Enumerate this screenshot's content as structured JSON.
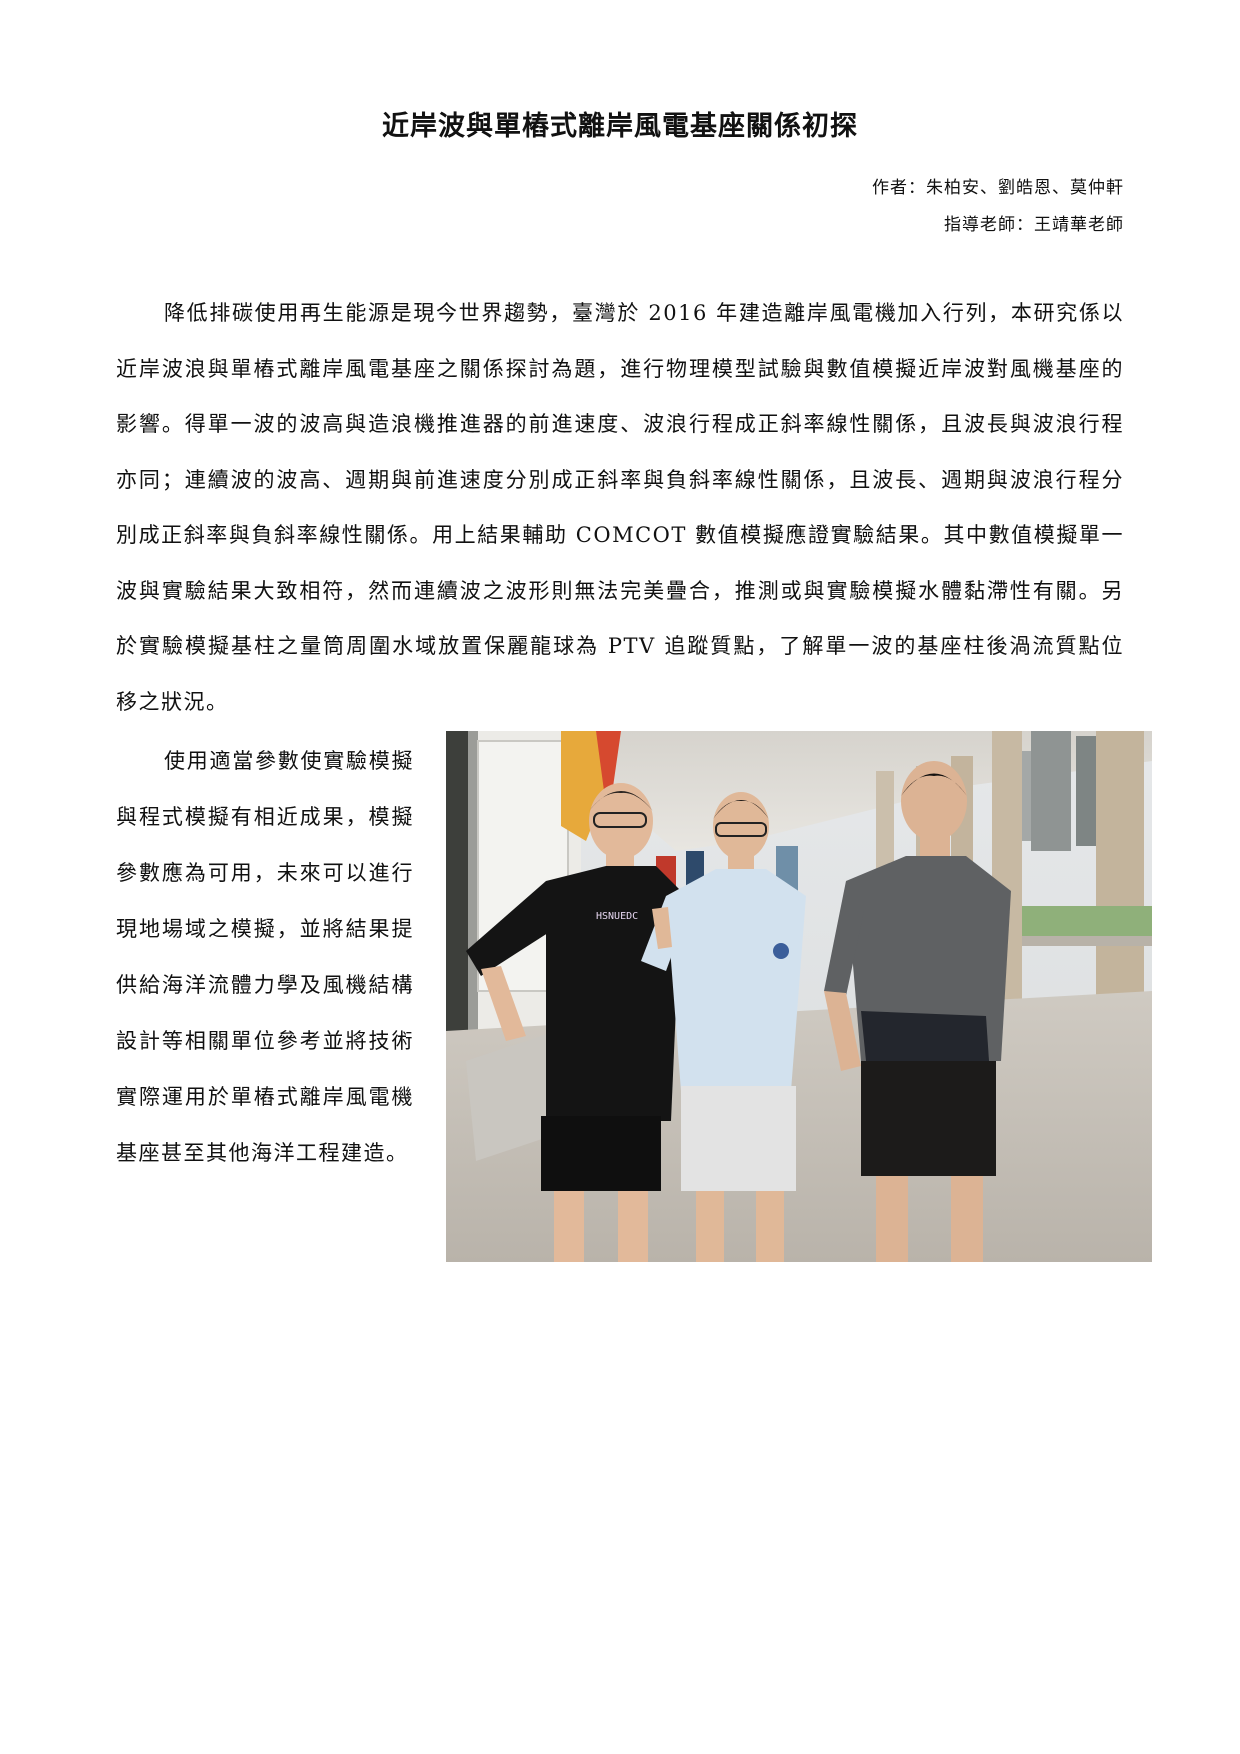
{
  "document": {
    "title": "近岸波與單樁式離岸風電基座關係初探",
    "authors_line": "作者：朱柏安、劉皓恩、莫仲軒",
    "advisor_line": "指導老師：王靖華老師",
    "abstract": "降低排碳使用再生能源是現今世界趨勢，臺灣於 2016 年建造離岸風電機加入行列，本研究係以近岸波浪與單樁式離岸風電基座之關係探討為題，進行物理模型試驗與數值模擬近岸波對風機基座的影響。得單一波的波高與造浪機推進器的前進速度、波浪行程成正斜率線性關係，且波長與波浪行程亦同；連續波的波高、週期與前進速度分別成正斜率與負斜率線性關係，且波長、週期與波浪行程分別成正斜率與負斜率線性關係。用上結果輔助 COMCOT 數值模擬應證實驗結果。其中數值模擬單一波與實驗結果大致相符，然而連續波之波形則無法完美疊合，推測或與實驗模擬水體黏滯性有關。另於實驗模擬基柱之量筒周圍水域放置保麗龍球為 PTV 追蹤質點，了解單一波的基座柱後渦流質點位移之狀況。",
    "closing": "使用適當參數使實驗模擬與程式模擬有相近成果，模擬參數應為可用，未來可以進行現地場域之模擬，並將結果提供給海洋流體力學及風機結構設計等相關單位參考並將技術實際運用於單樁式離岸風電機基座甚至其他海洋工程建造。",
    "shirt_print": "HSNUEDC"
  }
}
